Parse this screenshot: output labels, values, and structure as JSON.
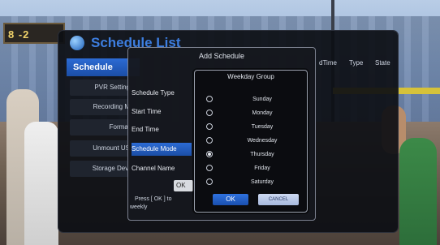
{
  "scene": {
    "scoreboard_text": "8 -2"
  },
  "main_panel": {
    "title": "Schedule List",
    "menu": [
      "Schedule",
      "PVR Setting",
      "Recording M",
      "Format",
      "Unmount US",
      "Storage Devi"
    ],
    "columns": [
      "dTime",
      "Type",
      "State"
    ]
  },
  "add_schedule": {
    "title": "Add Schedule",
    "fields": [
      {
        "label": "Schedule Type",
        "active": false
      },
      {
        "label": "Start Time",
        "active": false
      },
      {
        "label": "End Time",
        "active": false
      },
      {
        "label": "Schedule Mode",
        "active": true
      },
      {
        "label": "Channel Name",
        "active": false
      }
    ],
    "ok_label": "OK",
    "hint_line1": "Press [ OK ] to",
    "hint_line2": "weekly"
  },
  "weekday_group": {
    "title": "Weekday Group",
    "days": [
      {
        "label": "Sunday",
        "selected": false
      },
      {
        "label": "Monday",
        "selected": false
      },
      {
        "label": "Tuesday",
        "selected": false
      },
      {
        "label": "Wednesday",
        "selected": false
      },
      {
        "label": "Thursday",
        "selected": true
      },
      {
        "label": "Friday",
        "selected": false
      },
      {
        "label": "Saturday",
        "selected": false
      }
    ],
    "ok_label": "OK",
    "cancel_label": "CANCEL"
  }
}
